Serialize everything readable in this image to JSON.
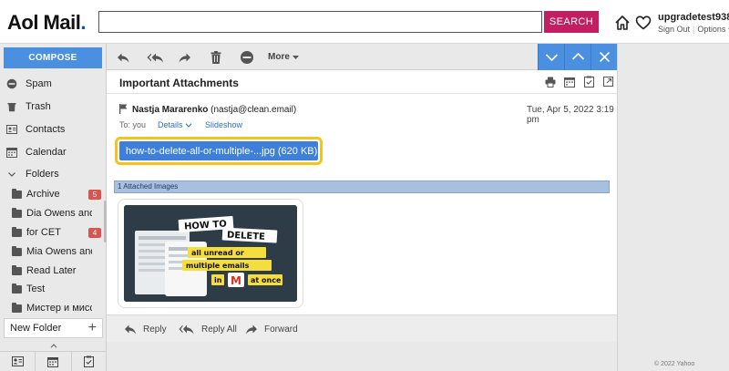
{
  "header": {
    "logo_text": "Aol Mail",
    "logo_dot": ".",
    "search_placeholder": "",
    "search_button": "SEARCH",
    "username": "upgradetest938",
    "sign_out": "Sign Out",
    "separator": "|",
    "options": "Options"
  },
  "sidebar": {
    "compose": "COMPOSE",
    "items": [
      {
        "label": "Spam",
        "icon": "spam-icon"
      },
      {
        "label": "Trash",
        "icon": "trash-icon"
      },
      {
        "label": "Contacts",
        "icon": "contacts-icon"
      },
      {
        "label": "Calendar",
        "icon": "calendar-icon"
      },
      {
        "label": "Folders",
        "icon": "chevron-down-icon"
      }
    ],
    "folders": [
      {
        "label": "Archive",
        "badge": "5"
      },
      {
        "label": "Dia Owens and ...",
        "badge": ""
      },
      {
        "label": "for CET",
        "badge": "4"
      },
      {
        "label": "Mia Owens and...",
        "badge": ""
      },
      {
        "label": "Read Later",
        "badge": ""
      },
      {
        "label": "Test",
        "badge": ""
      },
      {
        "label": "Мистер и мисс...",
        "badge": ""
      }
    ],
    "new_folder": "New Folder",
    "new_folder_plus": "+"
  },
  "toolbar": {
    "more": "More"
  },
  "message": {
    "subject": "Important Attachments",
    "sender_name": "Nastja Mararenko",
    "sender_email": "(nastja@clean.email)",
    "date": "Tue, Apr 5, 2022 3:19 pm",
    "to": "To: you",
    "details": "Details",
    "slideshow": "Slideshow",
    "attachment": "how-to-delete-all-or-multiple-...jpg (620 KB)",
    "attached_images": "1 Attached Images",
    "thumbnail": {
      "line1": "HOW TO",
      "line2": "DELETE",
      "line3": "all unread or",
      "line4": "multiple emails",
      "line5_pre": "in",
      "line5_post": "at once",
      "gmail_letter": "M"
    }
  },
  "reply_bar": {
    "reply": "Reply",
    "reply_all": "Reply All",
    "forward": "Forward"
  },
  "footer": {
    "copyright": "© 2022 Yahoo"
  },
  "colors": {
    "brand_blue": "#4a8fe0",
    "search_button": "#c21f62",
    "highlight": "#f5c31c",
    "badge_red": "#d9534f"
  }
}
